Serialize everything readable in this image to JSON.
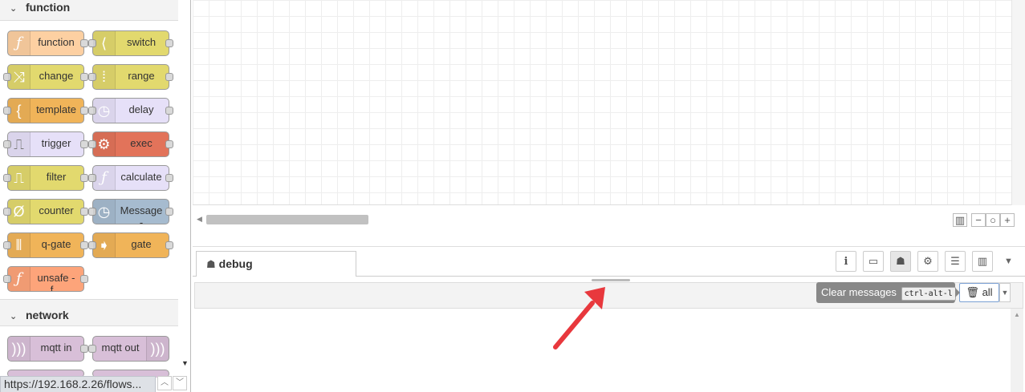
{
  "palette": {
    "categories": [
      {
        "name": "function",
        "collapsed": false
      },
      {
        "name": "network",
        "collapsed": false
      }
    ],
    "nodes": [
      {
        "label": "function",
        "icon": "function-icon",
        "color": "#fdd0a2"
      },
      {
        "label": "switch",
        "icon": "switch-icon",
        "color": "#e2d96e"
      },
      {
        "label": "change",
        "icon": "shuffle-icon",
        "color": "#e2d96e"
      },
      {
        "label": "range",
        "icon": "range-icon",
        "color": "#e2d96e"
      },
      {
        "label": "template",
        "icon": "template-icon",
        "color": "#f0b459"
      },
      {
        "label": "delay",
        "icon": "timer-icon",
        "color": "#e6e0f8"
      },
      {
        "label": "trigger",
        "icon": "trigger-icon",
        "color": "#e6e0f8"
      },
      {
        "label": "exec",
        "icon": "gear-icon",
        "color": "#e2735a"
      },
      {
        "label": "filter",
        "icon": "filter-icon",
        "color": "#e2d96e"
      },
      {
        "label": "calculate",
        "icon": "function-icon",
        "color": "#e6e0f8"
      },
      {
        "label": "counter",
        "icon": "counter-icon",
        "color": "#e2d96e"
      },
      {
        "label": "Message",
        "label2": "-",
        "icon": "history-icon",
        "color": "#a6bbcf"
      },
      {
        "label": "q-gate",
        "icon": "queue-gate-icon",
        "color": "#f0b459"
      },
      {
        "label": "gate",
        "icon": "gate-icon",
        "color": "#f0b459"
      },
      {
        "label": "unsafe -",
        "label2": "f...",
        "icon": "function-icon",
        "color": "#fda47a"
      },
      {
        "label": "mqtt in",
        "icon": "bridge-icon",
        "color": "#d8bfd8"
      },
      {
        "label": "mqtt out",
        "icon": "bridge-icon",
        "color": "#d8bfd8"
      }
    ],
    "status_url": "https://192.168.2.26/flows..."
  },
  "sidebar": {
    "tabs": [
      {
        "label": "debug",
        "icon": "bug-icon"
      }
    ],
    "toolbar_buttons": [
      {
        "icon": "info-icon",
        "glyph": "i"
      },
      {
        "icon": "book-icon",
        "glyph": "▭"
      },
      {
        "icon": "bug-icon",
        "glyph": "☗",
        "active": true
      },
      {
        "icon": "gear-icon",
        "glyph": "⚙"
      },
      {
        "icon": "database-icon",
        "glyph": "☰"
      },
      {
        "icon": "chart-icon",
        "glyph": "▥"
      }
    ],
    "debug": {
      "clear_all_label": "all",
      "tooltip": "Clear messages",
      "shortcut": "ctrl-alt-l"
    }
  },
  "colors": {
    "annotation_arrow": "#e8383d",
    "tooltip_bg": "#888888"
  }
}
